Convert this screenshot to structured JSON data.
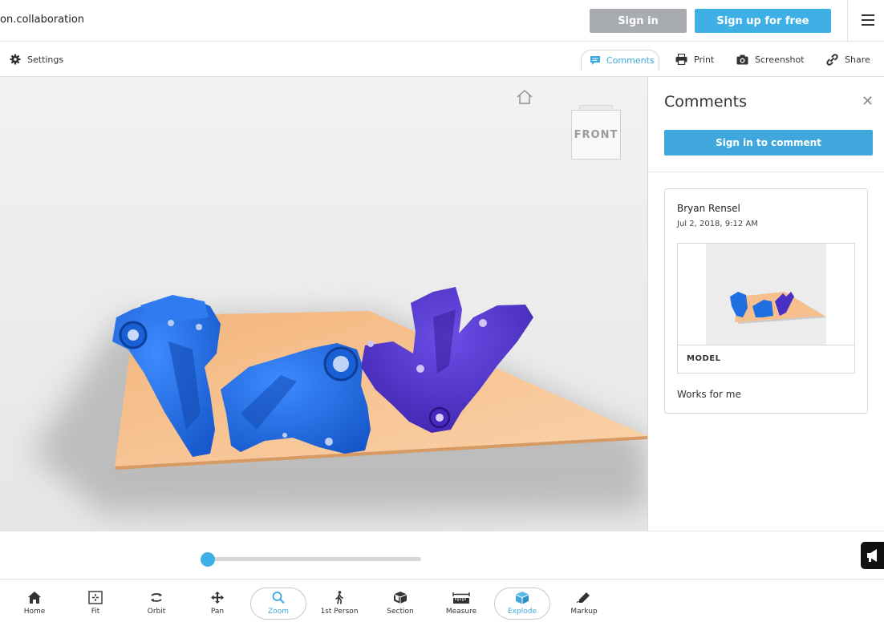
{
  "header": {
    "url_fragment": "on.collaboration",
    "sign_in_label": "Sign in",
    "sign_up_label": "Sign up for free"
  },
  "subbar": {
    "settings_label": "Settings",
    "comments_label": "Comments",
    "print_label": "Print",
    "screenshot_label": "Screenshot",
    "share_label": "Share"
  },
  "viewcube": {
    "face_label": "FRONT"
  },
  "comments_panel": {
    "title": "Comments",
    "sign_in_button": "Sign in to comment",
    "comment": {
      "author": "Bryan Rensel",
      "date": "Jul 2, 2018, 9:12 AM",
      "attachment_label": "MODEL",
      "body": "Works for me"
    }
  },
  "explode_slider": {
    "value": 0.0
  },
  "toolbar": {
    "home": "Home",
    "fit": "Fit",
    "orbit": "Orbit",
    "pan": "Pan",
    "zoom": "Zoom",
    "first_person": "1st Person",
    "section": "Section",
    "measure": "Measure",
    "explode": "Explode",
    "markup": "Markup"
  },
  "colors": {
    "accent": "#3fa7dc",
    "sign_in_gray": "#a8acb0",
    "model_blue": "#1f6fe0",
    "model_purple": "#4a2fc4",
    "platform": "#f6c08e"
  }
}
